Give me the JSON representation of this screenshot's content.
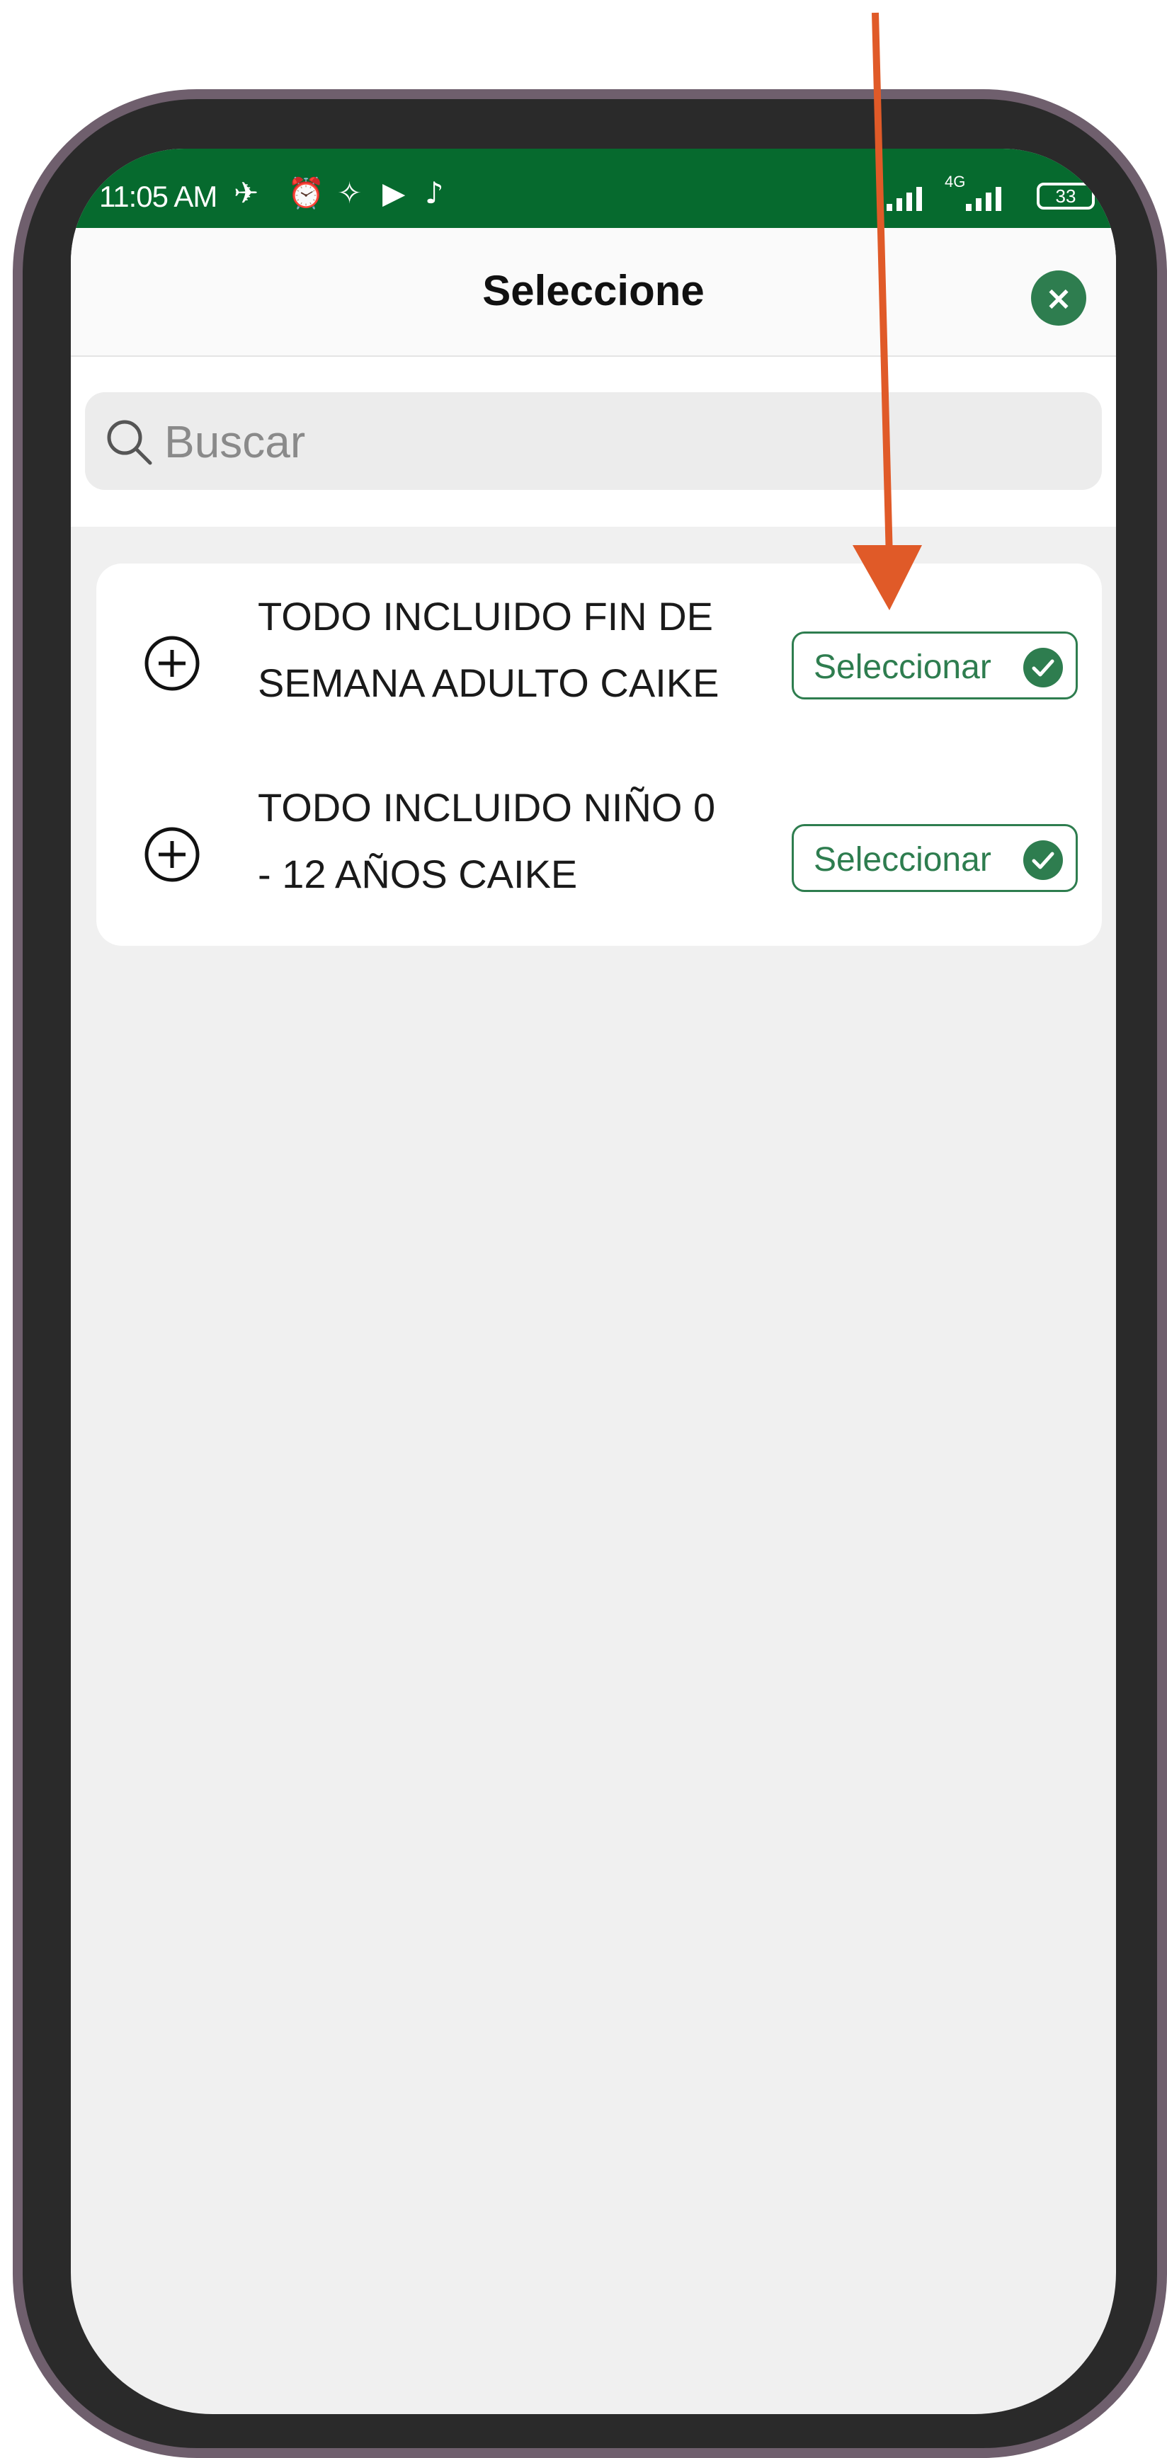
{
  "status_bar": {
    "time": "11:05 AM",
    "battery_level": "33",
    "network_label": "4G"
  },
  "header": {
    "title": "Seleccione"
  },
  "search": {
    "placeholder": "Buscar"
  },
  "items": [
    {
      "label_line1": "TODO INCLUIDO FIN DE",
      "label_line2": "SEMANA ADULTO CAIKE",
      "button_label": "Seleccionar"
    },
    {
      "label_line1": "TODO INCLUIDO NIÑO 0",
      "label_line2": "- 12 AÑOS CAIKE",
      "button_label": "Seleccionar"
    }
  ],
  "colors": {
    "status_bar": "#066a2e",
    "accent": "#2e7d4f",
    "annotation_arrow": "#e05a28",
    "background": "#f0f0f0"
  }
}
